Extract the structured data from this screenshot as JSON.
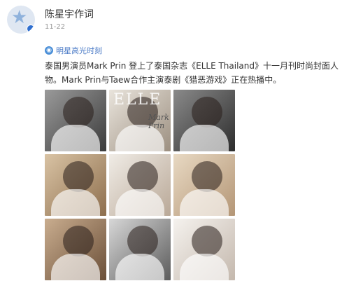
{
  "post": {
    "author": "陈星宇作词",
    "time": "11-22",
    "topic": "明星高光时刻",
    "text": "泰国男演员Mark Prin 登上了泰国杂志《ELLE Thailand》十一月刊时尚封面人物。Mark Prin与Taew合作主演泰剧《猎恶游戏》正在热播中。"
  },
  "photos": {
    "cover_title": "ELLE",
    "cover_name": "Mark Prin"
  },
  "colors": {
    "topic": "#4a7ac6",
    "avatar_badge": "#2f6fd0",
    "time": "#999999"
  }
}
